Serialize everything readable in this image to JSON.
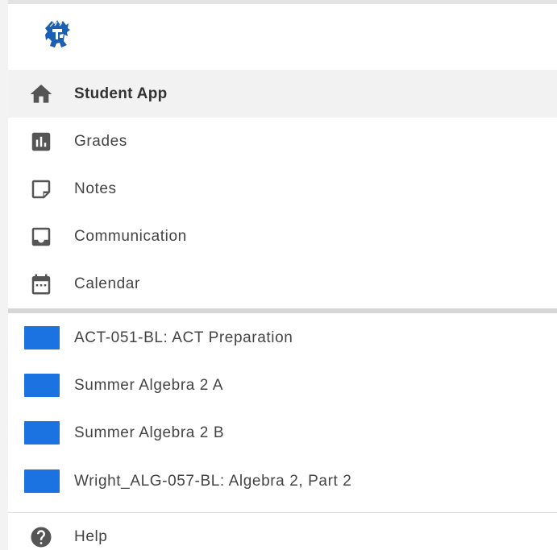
{
  "colors": {
    "course_swatch": "#1a73e0",
    "icon_gray": "#555555",
    "active_bg": "#f2f2f2"
  },
  "logo": {
    "icon": "spartan-helmet-logo"
  },
  "nav": [
    {
      "label": "Student App",
      "icon": "home-icon",
      "active": true
    },
    {
      "label": "Grades",
      "icon": "bar-chart-icon",
      "active": false
    },
    {
      "label": "Notes",
      "icon": "sticky-note-icon",
      "active": false
    },
    {
      "label": "Communication",
      "icon": "inbox-icon",
      "active": false
    },
    {
      "label": "Calendar",
      "icon": "calendar-icon",
      "active": false
    }
  ],
  "courses": [
    {
      "label": "ACT-051-BL: ACT Preparation"
    },
    {
      "label": "Summer Algebra 2 A"
    },
    {
      "label": "Summer Algebra 2 B"
    },
    {
      "label": "Wright_ALG-057-BL: Algebra 2, Part 2"
    }
  ],
  "footer": [
    {
      "label": "Help",
      "icon": "help-circle-icon"
    }
  ]
}
